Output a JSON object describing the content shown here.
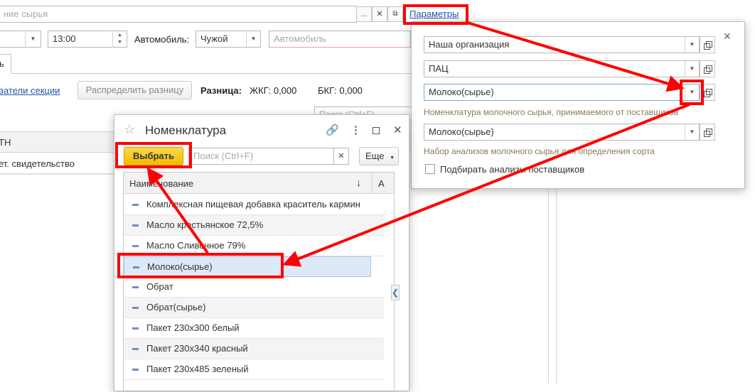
{
  "main": {
    "raw_material_placeholder": "ние сырья",
    "params_link": "Параметры",
    "time": "13:00",
    "car_label": "Автомобиль:",
    "car_type": "Чужой",
    "car_placeholder": "Автомобиль",
    "tab_partial": "ь",
    "section_link": "затели секции",
    "distribute_button": "Распределить разницу",
    "diff_label": "Разница:",
    "zhkg": "ЖКГ: 0,000",
    "bkg": "БКГ: 0,000",
    "search_placeholder": "Поиск (Ctrl+F)",
    "col_header_partial": "ТН",
    "row_partial": "ет. свидетельство"
  },
  "params_popup": {
    "org": "Наша организация",
    "pac": "ПАЦ",
    "nomenclature": "Молоко(сырье)",
    "nomenclature_hint": "Номенклатура молочного сырья, принимаемого от поставщиков",
    "analysis_set": "Молоко(сырье)",
    "analysis_hint": "Набор анализов молочного сырья для определения сорта",
    "checkbox_label": "Подбирать анализы поставщиков"
  },
  "nomenclature_dialog": {
    "title": "Номенклатура",
    "select_button": "Выбрать",
    "search_placeholder": "Поиск (Ctrl+F)",
    "more_button": "Еще",
    "column_header": "Наименование",
    "column_header2": "А",
    "items": [
      "Комплексная пищевая добавка краситель кармин",
      "Масло крестьянское 72,5%",
      "Масло Сливочное 79%",
      "Молоко(сырье)",
      "Обрат",
      "Обрат(сырье)",
      "Пакет 230х300 белый",
      "Пакет 230х340 красный",
      "Пакет 230х485 зеленый"
    ],
    "selected_index": 3
  },
  "colors": {
    "annotation_red": "#ff0000",
    "select_yellow": "#f6c400",
    "link_blue": "#1f56a8",
    "selection_row": "#dde9f7"
  }
}
